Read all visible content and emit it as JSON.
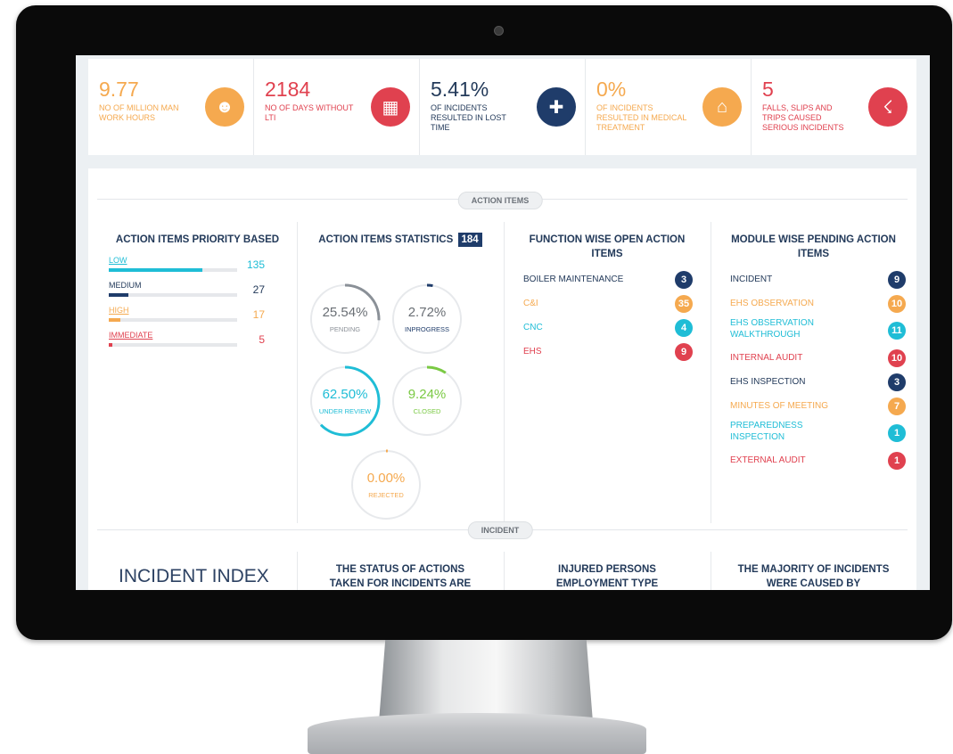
{
  "colors": {
    "orange": "#f5a94f",
    "red": "#e0414f",
    "navy": "#1f3c6a",
    "teal": "#1fbdd6",
    "dark": "#233a5a",
    "muted": "#7b8088"
  },
  "stats": [
    {
      "value": "9.77",
      "label": "NO OF MILLION MAN WORK HOURS",
      "color": "#f5a94f",
      "icon": "handshake-icon",
      "glyph": "☻"
    },
    {
      "value": "2184",
      "label": "NO OF DAYS WITHOUT LTI",
      "color": "#e0414f",
      "icon": "calendar-icon",
      "glyph": "▦"
    },
    {
      "value": "5.41%",
      "label": "OF INCIDENTS RESULTED IN LOST TIME",
      "color": "#1f3c6a",
      "icon": "injured-person-icon",
      "glyph": "✚"
    },
    {
      "value": "0%",
      "label": "OF INCIDENTS RESULTED IN MEDICAL TREATMENT",
      "color": "#f5a94f",
      "icon": "hospital-icon",
      "glyph": "⌂"
    },
    {
      "value": "5",
      "label": "FALLS, SLIPS AND TRIPS CAUSED SERIOUS INCIDENTS",
      "color": "#e0414f",
      "icon": "falling-person-icon",
      "glyph": "☇"
    }
  ],
  "sections": {
    "action_items": "ACTION ITEMS",
    "incident": "INCIDENT"
  },
  "priority": {
    "title": "ACTION ITEMS PRIORITY BASED",
    "items": [
      {
        "label": "LOW",
        "value": "135",
        "fraction": 0.73,
        "color": "#1fbdd6"
      },
      {
        "label": "MEDIUM",
        "value": "27",
        "fraction": 0.15,
        "color": "#1f3c6a"
      },
      {
        "label": "HIGH",
        "value": "17",
        "fraction": 0.09,
        "color": "#f5a94f"
      },
      {
        "label": "IMMEDIATE",
        "value": "5",
        "fraction": 0.03,
        "color": "#e0414f"
      }
    ]
  },
  "statistics": {
    "title": "ACTION ITEMS STATISTICS",
    "total": "184",
    "circles": [
      {
        "value": "25.54%",
        "label": "PENDING",
        "percent": 25.54,
        "color": "#8a9097"
      },
      {
        "value": "2.72%",
        "label": "INPROGRESS",
        "percent": 2.72,
        "color": "#1f3c6a"
      },
      {
        "value": "62.50%",
        "label": "UNDER REVIEW",
        "percent": 62.5,
        "color": "#1fbdd6"
      },
      {
        "value": "9.24%",
        "label": "CLOSED",
        "percent": 9.24,
        "color": "#7ac943"
      },
      {
        "value": "0.00%",
        "label": "REJECTED",
        "percent": 0,
        "color": "#f5a94f"
      }
    ]
  },
  "function_wise": {
    "title": "FUNCTION WISE OPEN ACTION ITEMS",
    "items": [
      {
        "label": "BOILER MAINTENANCE",
        "count": "3",
        "color": "#1f3c6a"
      },
      {
        "label": "C&I",
        "count": "35",
        "color": "#f5a94f"
      },
      {
        "label": "CNC",
        "count": "4",
        "color": "#1fbdd6"
      },
      {
        "label": "EHS",
        "count": "9",
        "color": "#e0414f"
      }
    ]
  },
  "module_wise": {
    "title": "MODULE WISE PENDING ACTION ITEMS",
    "items": [
      {
        "label": "INCIDENT",
        "count": "9",
        "color": "#1f3c6a"
      },
      {
        "label": "EHS OBSERVATION",
        "count": "10",
        "color": "#f5a94f"
      },
      {
        "label": "EHS OBSERVATION WALKTHROUGH",
        "count": "11",
        "color": "#1fbdd6"
      },
      {
        "label": "INTERNAL AUDIT",
        "count": "10",
        "color": "#e0414f"
      },
      {
        "label": "EHS INSPECTION",
        "count": "3",
        "color": "#1f3c6a"
      },
      {
        "label": "MINUTES OF MEETING",
        "count": "7",
        "color": "#f5a94f"
      },
      {
        "label": "PREPAREDNESS INSPECTION",
        "count": "1",
        "color": "#1fbdd6"
      },
      {
        "label": "EXTERNAL AUDIT",
        "count": "1",
        "color": "#e0414f"
      }
    ]
  },
  "incident": {
    "index_title": "INCIDENT INDEX",
    "status_title": "THE STATUS OF ACTIONS TAKEN FOR INCIDENTS ARE",
    "injured_title": "INJURED PERSONS EMPLOYMENT TYPE",
    "majority_title": "THE MAJORITY OF INCIDENTS WERE CAUSED BY"
  }
}
